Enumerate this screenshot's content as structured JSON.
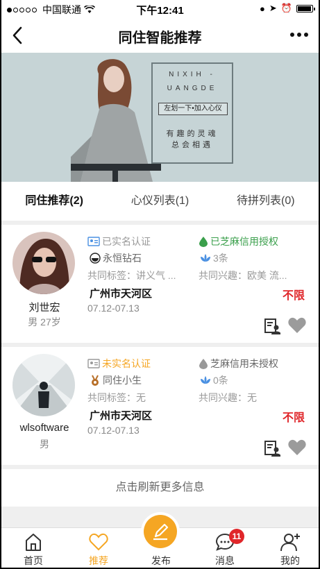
{
  "status_bar": {
    "carrier": "中国联通",
    "time": "下午12:41"
  },
  "nav": {
    "title": "同住智能推荐"
  },
  "banner": {
    "line1": "NIXIH -",
    "line2": "UANGDE",
    "pill": "左划一下•加入心仪",
    "line3": "有趣的灵魂",
    "line4": "总会相遇"
  },
  "tabs": [
    {
      "label": "同住推荐(2)"
    },
    {
      "label": "心仪列表(1)"
    },
    {
      "label": "待拼列表(0)"
    }
  ],
  "cards": [
    {
      "name": "刘世宏",
      "meta": "男 27岁",
      "verify": "已实名认证",
      "credit": "已芝麻信用授权",
      "level": "永恒钻石",
      "count": "3条",
      "tags": "共同标签：讲义气 ...",
      "interests": "共同兴趣：欧美 流...",
      "location": "广州市天河区",
      "dates": "07.12-07.13",
      "price": "不限"
    },
    {
      "name": "wlsoftware",
      "meta": "男",
      "verify": "未实名认证",
      "credit": "芝麻信用未授权",
      "level": "同住小生",
      "count": "0条",
      "tags": "共同标签：无",
      "interests": "共同兴趣：无",
      "location": "广州市天河区",
      "dates": "07.12-07.13",
      "price": "不限"
    }
  ],
  "refresh": "点击刷新更多信息",
  "tabbar": {
    "home": "首页",
    "recommend": "推荐",
    "publish": "发布",
    "messages": "消息",
    "messages_badge": "11",
    "mine": "我的"
  },
  "colors": {
    "accent": "#f5a623",
    "price": "#e0262a",
    "green": "#3a9f4b"
  }
}
